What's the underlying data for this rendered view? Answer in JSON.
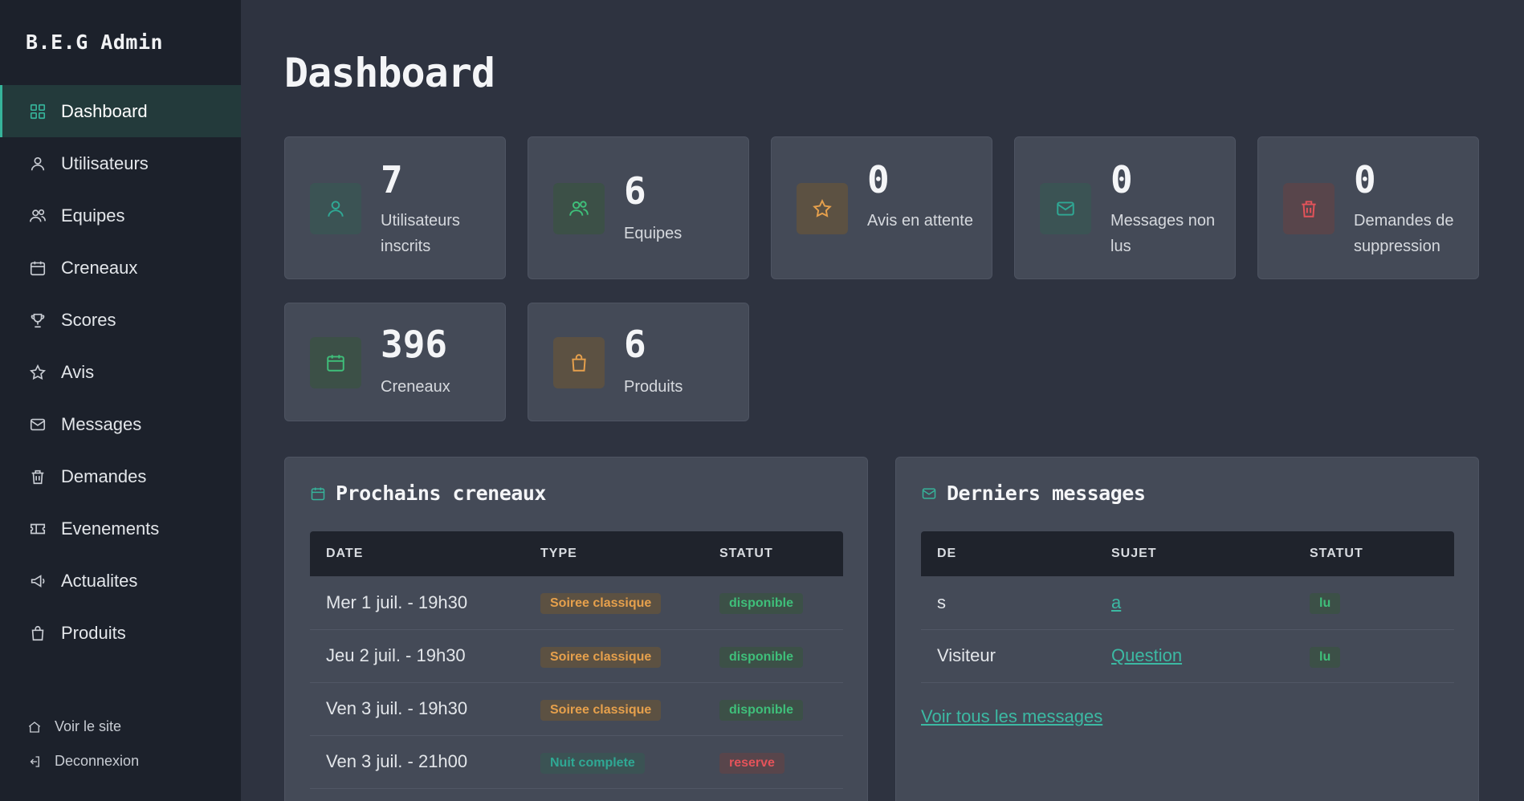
{
  "sidebar": {
    "brand": "B.E.G Admin",
    "items": [
      {
        "label": "Dashboard",
        "icon": "grid-icon"
      },
      {
        "label": "Utilisateurs",
        "icon": "user-icon"
      },
      {
        "label": "Equipes",
        "icon": "users-icon"
      },
      {
        "label": "Creneaux",
        "icon": "calendar-icon"
      },
      {
        "label": "Scores",
        "icon": "trophy-icon"
      },
      {
        "label": "Avis",
        "icon": "star-icon"
      },
      {
        "label": "Messages",
        "icon": "mail-icon"
      },
      {
        "label": "Demandes",
        "icon": "trash-icon"
      },
      {
        "label": "Evenements",
        "icon": "ticket-icon"
      },
      {
        "label": "Actualites",
        "icon": "megaphone-icon"
      },
      {
        "label": "Produits",
        "icon": "bag-icon"
      }
    ],
    "footer": {
      "view_site": "Voir le site",
      "logout": "Deconnexion"
    }
  },
  "page": {
    "title": "Dashboard"
  },
  "stats": [
    {
      "value": "7",
      "label": "Utilisateurs inscrits",
      "icon": "user-icon",
      "color": "#2fa894"
    },
    {
      "value": "6",
      "label": "Equipes",
      "icon": "users-icon",
      "color": "#3fbf7a"
    },
    {
      "value": "0",
      "label": "Avis en attente",
      "icon": "star-icon",
      "color": "#e6a04c"
    },
    {
      "value": "0",
      "label": "Messages non lus",
      "icon": "mail-icon",
      "color": "#2fa894"
    },
    {
      "value": "0",
      "label": "Demandes de suppression",
      "icon": "trash-icon",
      "color": "#e5535a"
    },
    {
      "value": "396",
      "label": "Creneaux",
      "icon": "calendar-icon",
      "color": "#3fbf7a"
    },
    {
      "value": "6",
      "label": "Produits",
      "icon": "bag-icon",
      "color": "#e6a04c"
    }
  ],
  "slots_panel": {
    "title": "Prochains creneaux",
    "columns": [
      "DATE",
      "TYPE",
      "STATUT"
    ],
    "rows": [
      {
        "date": "Mer 1 juil. - 19h30",
        "type": "Soiree classique",
        "status": "disponible"
      },
      {
        "date": "Jeu 2 juil. - 19h30",
        "type": "Soiree classique",
        "status": "disponible"
      },
      {
        "date": "Ven 3 juil. - 19h30",
        "type": "Soiree classique",
        "status": "disponible"
      },
      {
        "date": "Ven 3 juil. - 21h00",
        "type": "Nuit complete",
        "status": "reserve"
      }
    ]
  },
  "messages_panel": {
    "title": "Derniers messages",
    "columns": [
      "DE",
      "SUJET",
      "STATUT"
    ],
    "rows": [
      {
        "from": "s",
        "subject": "a",
        "status": "lu"
      },
      {
        "from": "Visiteur",
        "subject": "Question",
        "status": "lu"
      }
    ],
    "view_all": "Voir tous les messages"
  },
  "colors": {
    "accent": "#36b39a",
    "sidebar_bg": "#1c212b",
    "main_bg": "#2e3340",
    "card_bg": "#444a57"
  }
}
